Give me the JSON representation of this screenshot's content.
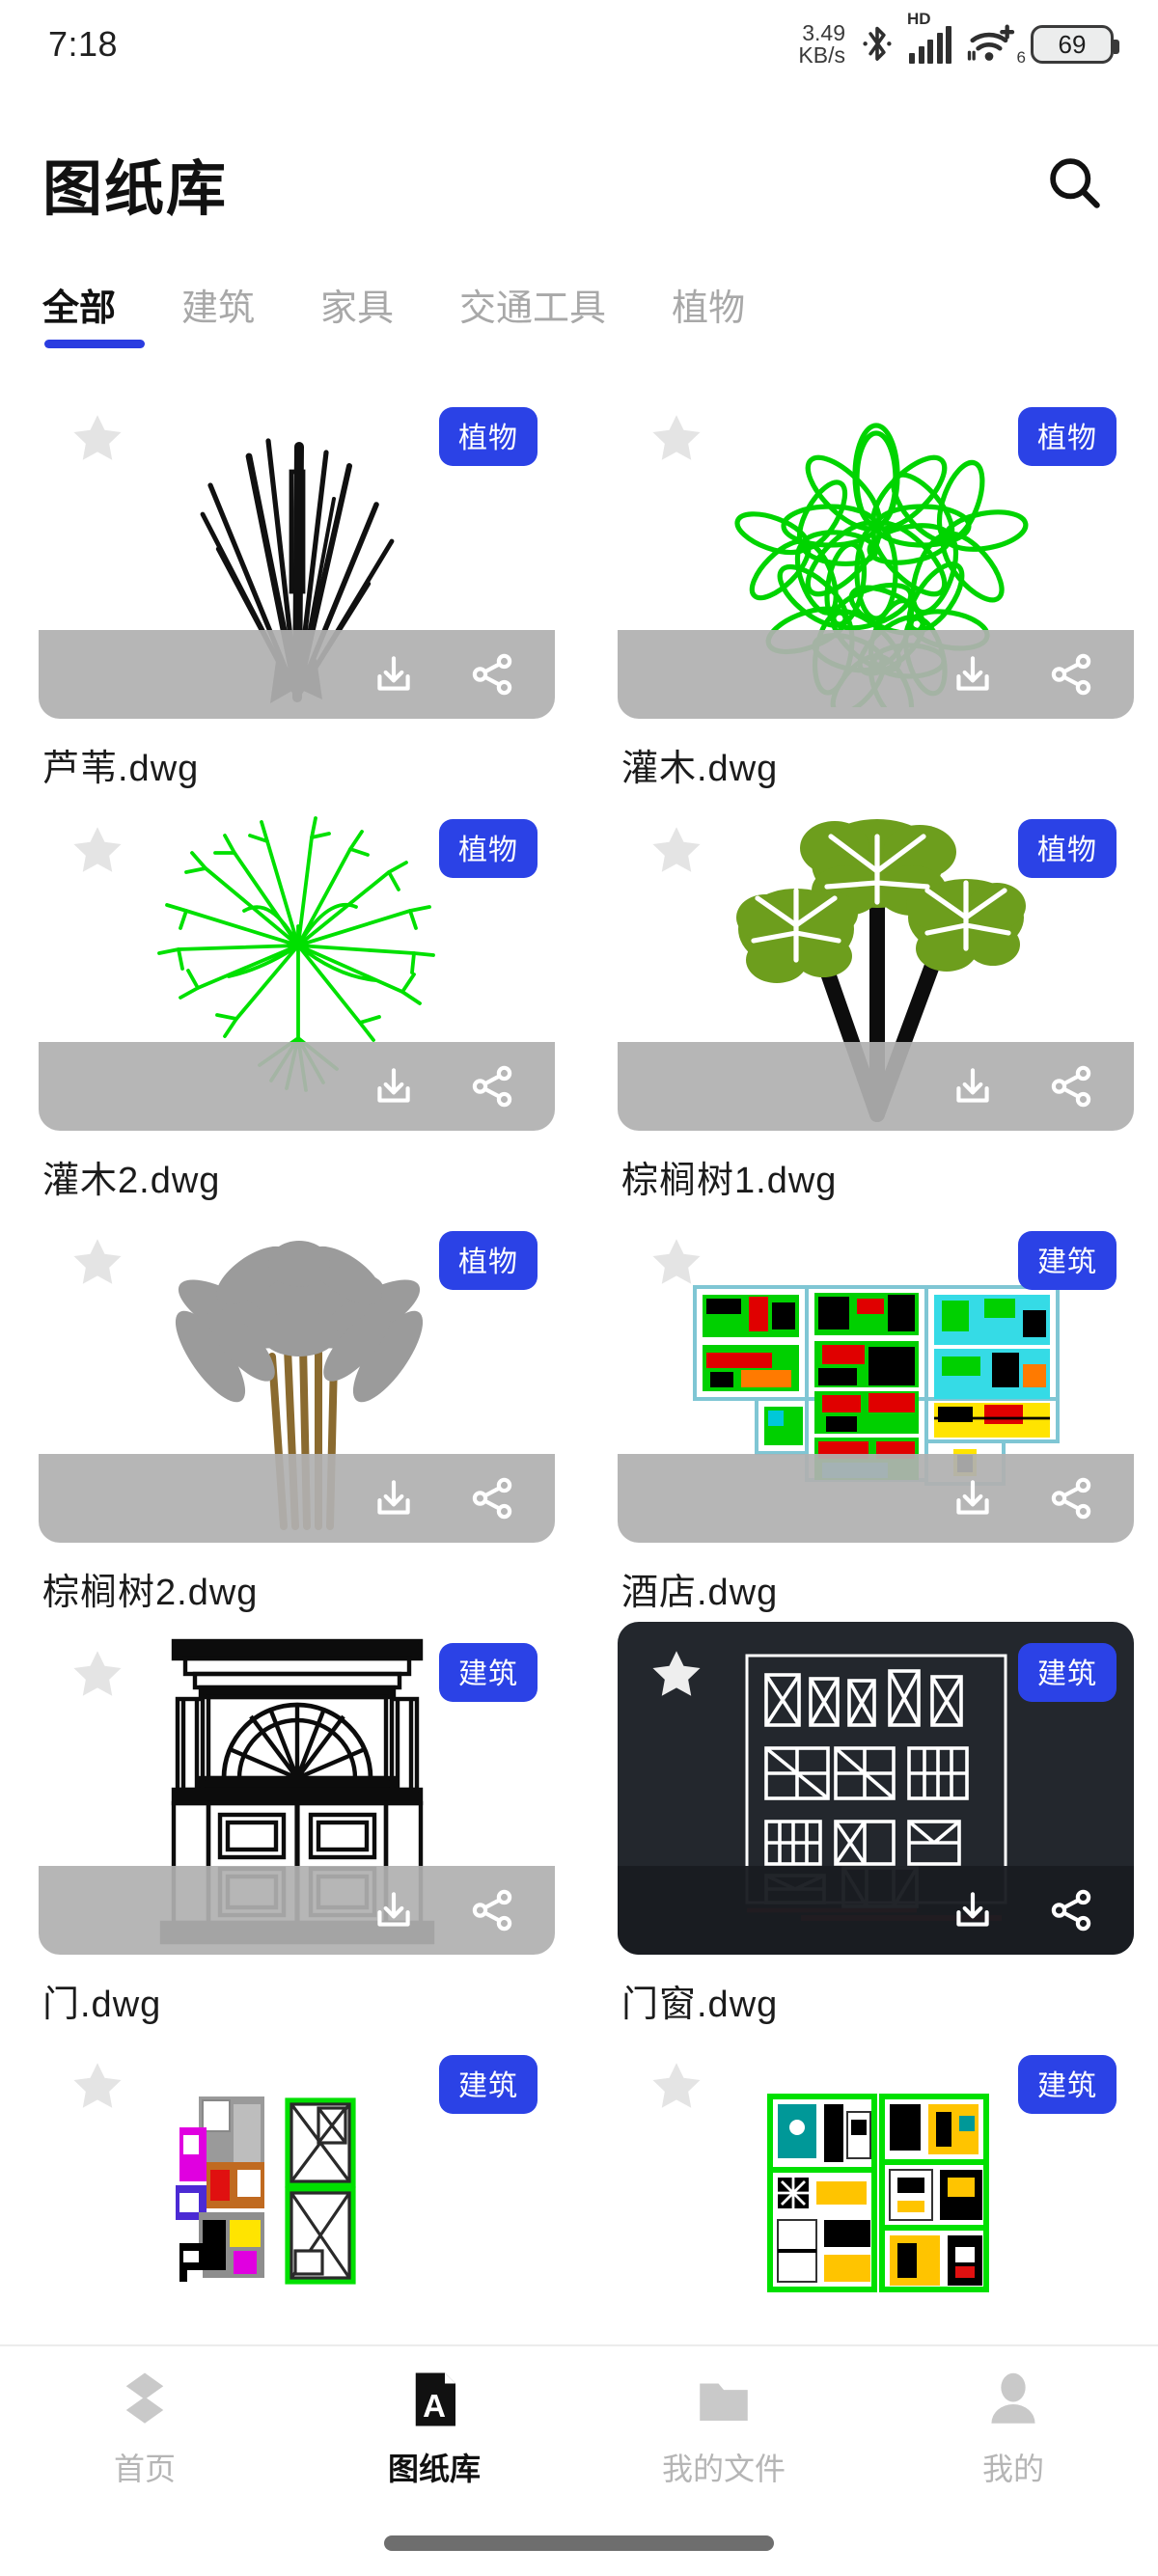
{
  "status_bar": {
    "time": "7:18",
    "net_speed_value": "3.49",
    "net_speed_unit": "KB/s",
    "bluetooth_icon": "bluetooth-icon",
    "hd_label": "HD",
    "signal_icon": "cellular-signal-icon",
    "wifi_icon": "wifi-plus-icon",
    "wifi_generation": "6",
    "battery_level": "69"
  },
  "header": {
    "title": "图纸库",
    "search_icon": "search-icon"
  },
  "tabs": [
    {
      "label": "全部",
      "active": true
    },
    {
      "label": "建筑",
      "active": false
    },
    {
      "label": "家具",
      "active": false
    },
    {
      "label": "交通工具",
      "active": false
    },
    {
      "label": "植物",
      "active": false
    }
  ],
  "accent_color": "#2b42e6",
  "cards": [
    {
      "filename": "芦苇.dwg",
      "badge": "植物",
      "favorited": false,
      "theme": "light",
      "thumb": "reed-drawing"
    },
    {
      "filename": "灌木.dwg",
      "badge": "植物",
      "favorited": false,
      "theme": "light",
      "thumb": "shrub-green-drawing"
    },
    {
      "filename": "灌木2.dwg",
      "badge": "植物",
      "favorited": false,
      "theme": "light",
      "thumb": "shrub2-green-drawing"
    },
    {
      "filename": "棕榈树1.dwg",
      "badge": "植物",
      "favorited": false,
      "theme": "light",
      "thumb": "palm-tree-1-drawing"
    },
    {
      "filename": "棕榈树2.dwg",
      "badge": "植物",
      "favorited": false,
      "theme": "light",
      "thumb": "palm-tree-2-drawing"
    },
    {
      "filename": "酒店.dwg",
      "badge": "建筑",
      "favorited": false,
      "theme": "light",
      "thumb": "hotel-floorplan-drawing"
    },
    {
      "filename": "门.dwg",
      "badge": "建筑",
      "favorited": false,
      "theme": "light",
      "thumb": "door-elevation-drawing"
    },
    {
      "filename": "门窗.dwg",
      "badge": "建筑",
      "favorited": true,
      "theme": "dark",
      "thumb": "door-window-schedule-drawing"
    },
    {
      "filename": "",
      "badge": "建筑",
      "favorited": false,
      "theme": "light",
      "thumb": "apartment-plan-drawing"
    },
    {
      "filename": "",
      "badge": "建筑",
      "favorited": false,
      "theme": "light",
      "thumb": "colored-plan-drawing"
    }
  ],
  "card_actions": {
    "download_icon": "download-icon",
    "share_icon": "share-icon",
    "star_icon": "star-icon"
  },
  "bottom_nav": [
    {
      "label": "首页",
      "icon": "home-chevrons-icon",
      "active": false
    },
    {
      "label": "图纸库",
      "icon": "document-a-icon",
      "active": true
    },
    {
      "label": "我的文件",
      "icon": "folder-icon",
      "active": false
    },
    {
      "label": "我的",
      "icon": "person-icon",
      "active": false
    }
  ]
}
